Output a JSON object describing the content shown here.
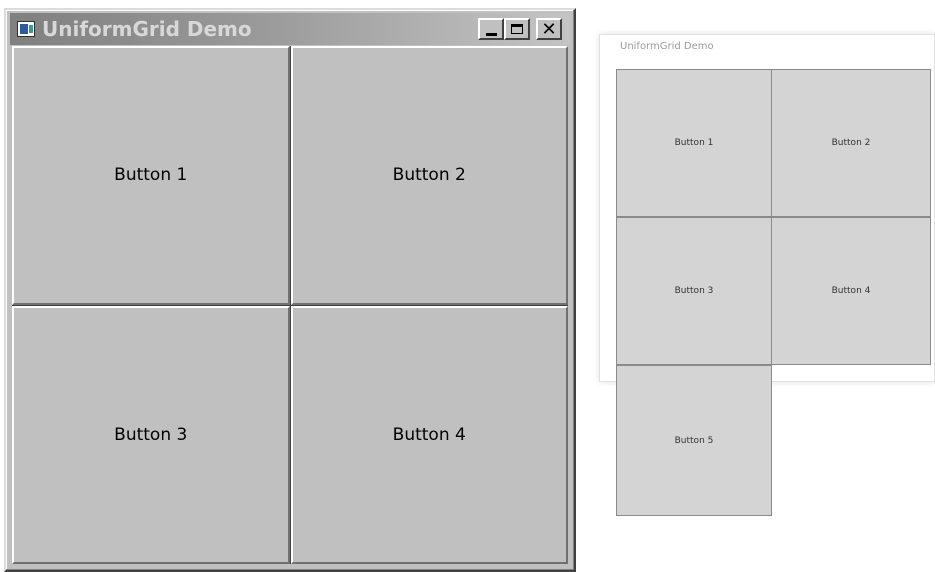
{
  "window_classic": {
    "title": "UniformGrid Demo",
    "buttons": [
      "Button 1",
      "Button 2",
      "Button 3",
      "Button 4"
    ],
    "caption_buttons": {
      "minimize": "minimize-icon",
      "maximize": "maximize-icon",
      "close": "✕"
    }
  },
  "window_modern": {
    "title": "UniformGrid Demo",
    "buttons": [
      "Button 1",
      "Button 2",
      "Button 3",
      "Button 4",
      "Button 5"
    ]
  },
  "colors": {
    "classic_face": "#c0c0c0",
    "modern_face": "#d4d4d4",
    "title_gradient_start": "#808080",
    "title_gradient_end": "#c4c4c4"
  }
}
